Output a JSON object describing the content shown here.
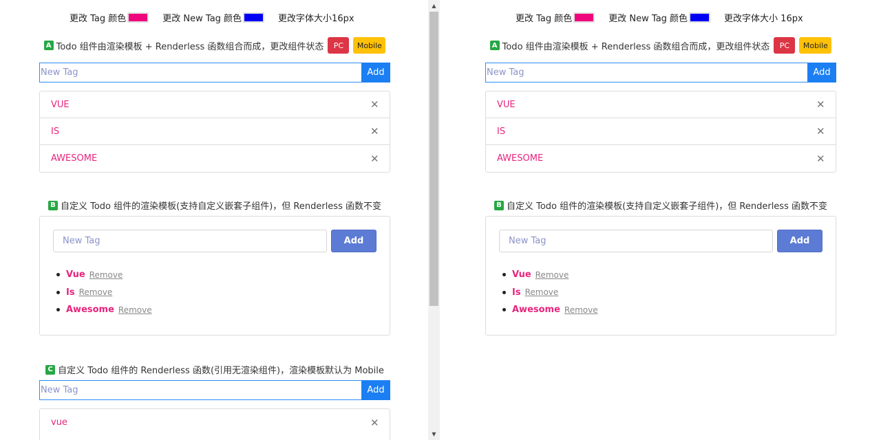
{
  "controls": {
    "tag_color_label": "更改 Tag 颜色",
    "new_tag_color_label": "更改 New Tag 颜色",
    "font_size_label": "更改字体大小16px",
    "font_size_label_right": "更改字体大小 16px",
    "tag_color": "#f0067c",
    "new_tag_color": "#0000f5"
  },
  "section_a": {
    "badge": "A",
    "title": "Todo 组件由渲染模板 + Renderless 函数组合而成，更改组件状态",
    "pc_label": "PC",
    "mobile_label": "Mobile",
    "input_placeholder": "New Tag",
    "add_label": "Add",
    "tags": [
      "VUE",
      "IS",
      "AWESOME"
    ]
  },
  "section_b": {
    "badge": "B",
    "title": "自定义 Todo 组件的渲染模板(支持自定义嵌套子组件)，但 Renderless 函数不变",
    "input_placeholder": "New Tag",
    "add_label": "Add",
    "remove_label": "Remove",
    "tags": [
      "Vue",
      "Is",
      "Awesome"
    ]
  },
  "section_c": {
    "badge": "C",
    "title": "自定义 Todo 组件的 Renderless 函数(引用无渲染组件)，渲染模板默认为 Mobile",
    "input_placeholder": "New Tag",
    "add_label": "Add",
    "tags": [
      "vue"
    ]
  },
  "colors": {
    "accent_blue": "#1b7ff3",
    "tag_text": "#e8247d",
    "add_button_b": "#5c7bd4",
    "badge_green": "#28a745",
    "pc_red": "#dc3545",
    "mobile_yellow": "#ffc107"
  }
}
